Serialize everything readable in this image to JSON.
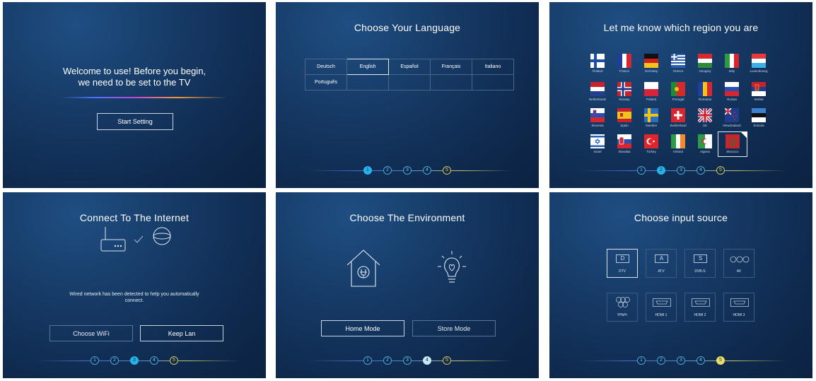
{
  "screen1": {
    "line1": "Welcome to use! Before you begin,",
    "line2": "we need to be set to the TV",
    "button": "Start Setting"
  },
  "screen2": {
    "title": "Choose Your Language",
    "languages": [
      "Deutsch",
      "English",
      "Español",
      "Français",
      "Italiano",
      "Português"
    ],
    "selected": "English",
    "steps": [
      "1",
      "2",
      "3",
      "4",
      "5"
    ]
  },
  "screen3": {
    "title": "Let me know which region you are",
    "regions": [
      "Finland",
      "France",
      "Germany",
      "Greece",
      "Hungary",
      "Italy",
      "Luxembourg",
      "Netherlands",
      "Norway",
      "Poland",
      "Portugal",
      "Romania",
      "Russia",
      "Serbia",
      "Slovenia",
      "Spain",
      "Sweden",
      "Switzerland",
      "UK",
      "NewZealand",
      "Estonia",
      "Israel",
      "Slovakia",
      "Turkey",
      "Ireland",
      "Algeria",
      "Morocco"
    ],
    "selected": "Morocco",
    "steps": [
      "1",
      "2",
      "3",
      "4",
      "5"
    ]
  },
  "screen4": {
    "title": "Connect To The Internet",
    "message_line1": "Wired network has been detected to help you automatically",
    "message_line2": "connect.",
    "button_wifi": "Choose WiFi",
    "button_lan": "Keep Lan",
    "steps": [
      "1",
      "2",
      "3",
      "4",
      "5"
    ]
  },
  "screen5": {
    "title": "Choose The Environment",
    "button_home": "Home Mode",
    "button_store": "Store Mode",
    "steps": [
      "1",
      "2",
      "3",
      "4",
      "5"
    ]
  },
  "screen6": {
    "title": "Choose input source",
    "sources": [
      {
        "label": "DTV",
        "glyph": "D",
        "icon": "box-letter-icon"
      },
      {
        "label": "ATV",
        "glyph": "A",
        "icon": "box-letter-icon"
      },
      {
        "label": "DVB-S",
        "glyph": "S",
        "icon": "box-letter-icon"
      },
      {
        "label": "AV",
        "glyph": "",
        "icon": "av-circles-icon"
      },
      {
        "label": "YPbPr",
        "glyph": "",
        "icon": "component-circles-icon"
      },
      {
        "label": "HDMI 1",
        "glyph": "",
        "icon": "hdmi-icon"
      },
      {
        "label": "HDMI 2",
        "glyph": "",
        "icon": "hdmi-icon"
      },
      {
        "label": "HDMI 3",
        "glyph": "",
        "icon": "hdmi-icon"
      }
    ],
    "selected": "DTV",
    "steps": [
      "1",
      "2",
      "3",
      "4",
      "5"
    ]
  }
}
